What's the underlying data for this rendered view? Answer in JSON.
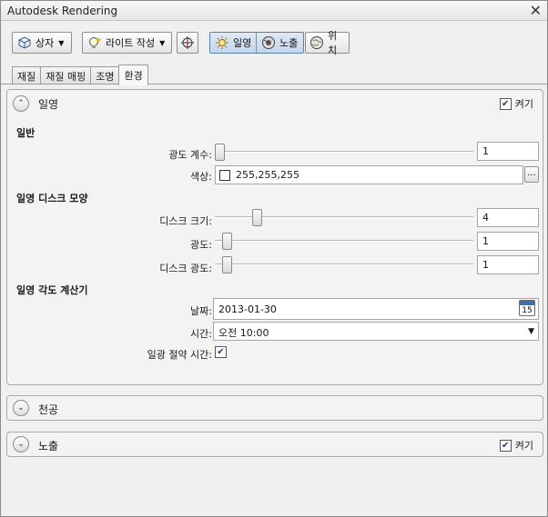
{
  "window": {
    "title": "Autodesk Rendering",
    "close_glyph": "✕"
  },
  "toolbar": {
    "box_label": "상자",
    "light_label": "라이트 작성",
    "sun_label": "일영",
    "exposure_label": "노출",
    "location_label": "위치",
    "dropdown_glyph": "▼"
  },
  "tabs": [
    {
      "label": "재질",
      "active": false
    },
    {
      "label": "재질 매핑",
      "active": false
    },
    {
      "label": "조명",
      "active": false
    },
    {
      "label": "환경",
      "active": true
    }
  ],
  "sun_panel": {
    "title": "일영",
    "on_label": "켜기",
    "on_checked": true,
    "general": {
      "heading": "일반",
      "intensity_label": "광도 계수:",
      "intensity_value": "1",
      "intensity_slider": 0.0,
      "color_label": "색상:",
      "color_value": "255,255,255",
      "browse_label": "..."
    },
    "disc": {
      "heading": "일영 디스크 모양",
      "size_label": "디스크 크기:",
      "size_value": "4",
      "size_slider": 0.15,
      "glow_label": "광도:",
      "glow_value": "1",
      "glow_slider": 0.03,
      "disc_intensity_label": "디스크 광도:",
      "disc_intensity_value": "1",
      "disc_intensity_slider": 0.03
    },
    "angle": {
      "heading": "일영 각도 계산기",
      "date_label": "날짜:",
      "date_value": "2013-01-30",
      "calendar_day": "15",
      "time_label": "시간:",
      "time_value": "오전 10:00",
      "dst_label": "일광 절약 시간:",
      "dst_checked": true
    }
  },
  "sky_panel": {
    "title": "천공"
  },
  "exposure_panel": {
    "title": "노출",
    "on_label": "켜기",
    "on_checked": true
  },
  "glyphs": {
    "check": "✔",
    "chevron_up": "⌃",
    "chevron_down": "⌄",
    "select_arrow": "▼"
  },
  "colors": {
    "accent": "#3e6fb3",
    "active_btn": "#c4d6ec"
  }
}
